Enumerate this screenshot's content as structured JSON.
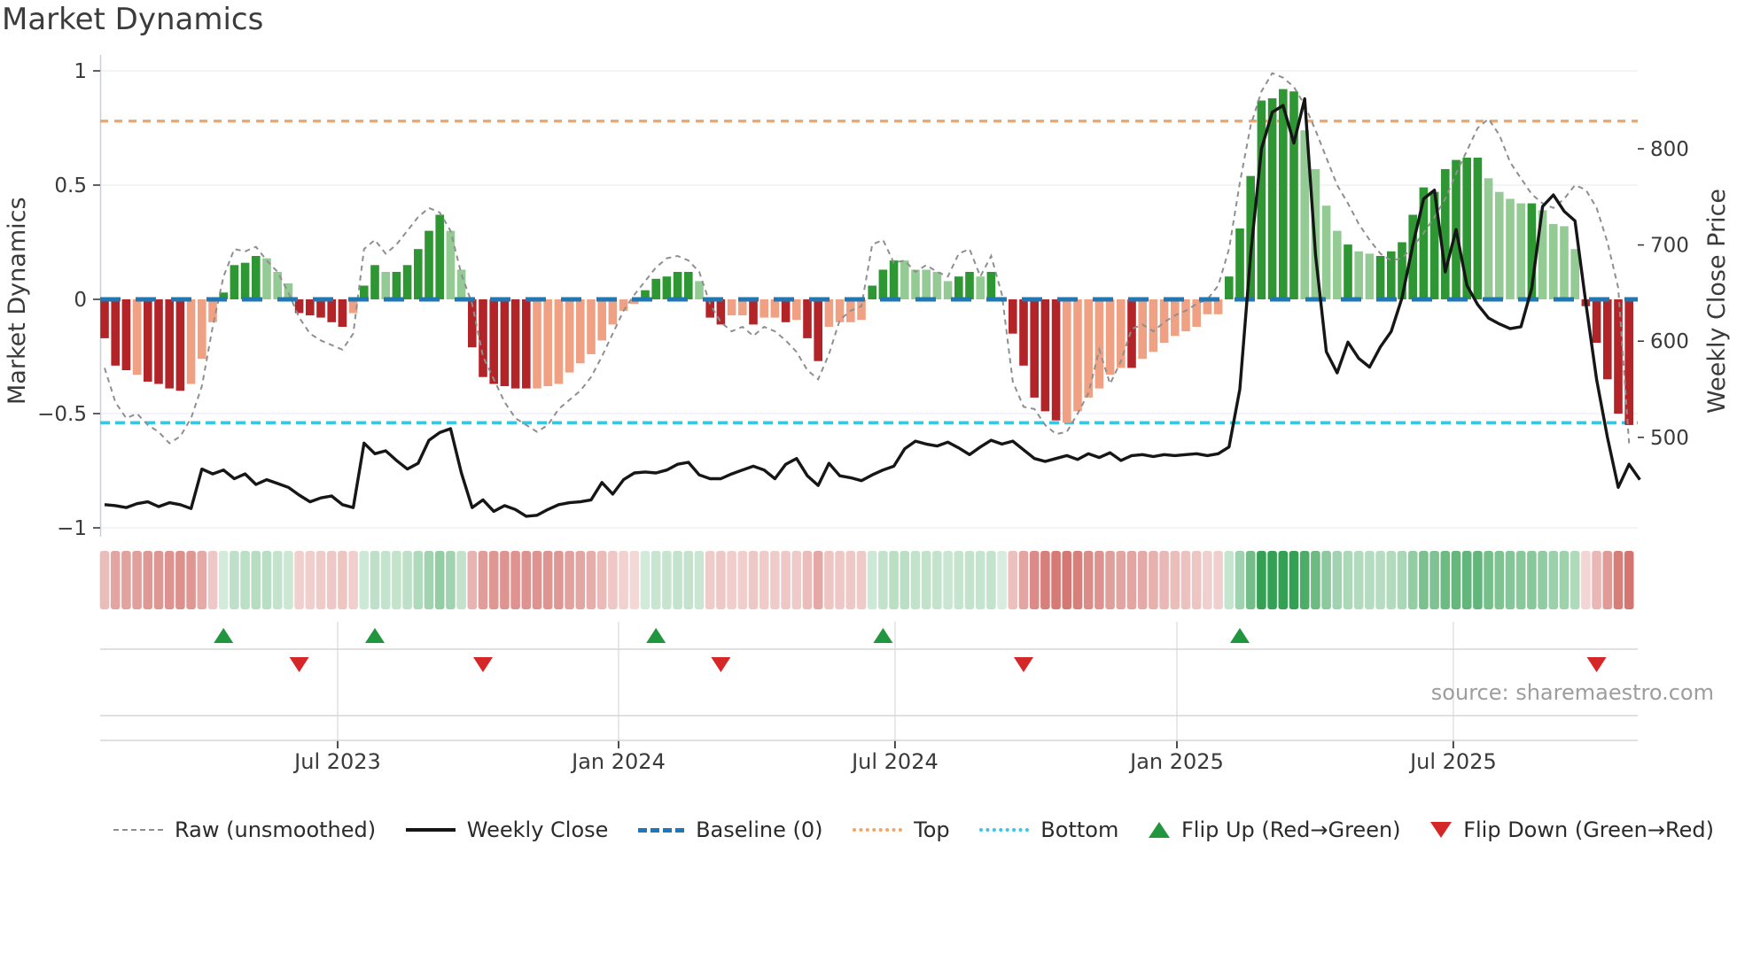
{
  "title": "Market Dynamics",
  "source": "source: sharemaestro.com",
  "colors": {
    "bar_dark_red": "#b22428",
    "bar_salmon": "#f0a183",
    "bar_dark_green": "#2e9632",
    "bar_light_green": "#94cb94",
    "strip_red": "#c23b34",
    "strip_green": "#34a053",
    "baseline": "#1f77b4",
    "top_line": "#f2a465",
    "bottom_line": "#38c6e6",
    "raw_line": "#8f8f8f",
    "price_line": "#161616",
    "flip_up": "#21963f",
    "flip_down": "#d62728",
    "grid": "#eef0f5",
    "spine": "#cdd0d8",
    "panel_line": "#d6d6d6",
    "panel_grid": "#e3e3e8"
  },
  "legend": [
    {
      "label": "Raw (unsmoothed)",
      "swatch": "raw"
    },
    {
      "label": "Weekly Close",
      "swatch": "close"
    },
    {
      "label": "Baseline (0)",
      "swatch": "base"
    },
    {
      "label": "Top",
      "swatch": "top"
    },
    {
      "label": "Bottom",
      "swatch": "bot"
    },
    {
      "label": "Flip Up (Red→Green)",
      "swatch": "up"
    },
    {
      "label": "Flip Down (Green→Red)",
      "swatch": "down"
    }
  ],
  "chart_data": {
    "type": "bar",
    "subtype": "weekly oscillator bars + raw dashed line + price line + heatmap strip + flip markers",
    "n_weeks": 142,
    "left_axis": {
      "label": "Market Dynamics",
      "ticks": [
        "1",
        "0.5",
        "0",
        "−0.5",
        "−1"
      ],
      "tick_values": [
        1,
        0.5,
        0,
        -0.5,
        -1
      ],
      "range": [
        -1.06,
        1.06
      ]
    },
    "right_axis": {
      "label": "Weekly Close Price",
      "ticks": [
        "800",
        "700",
        "600",
        "500"
      ],
      "tick_values": [
        800,
        700,
        600,
        500
      ]
    },
    "x_axis": {
      "tick_labels": [
        "Jul 2023",
        "Jan 2024",
        "Jul 2024",
        "Jan 2025",
        "Jul 2025"
      ],
      "tick_indices": [
        21.56,
        47.54,
        73.11,
        99.18,
        124.75
      ]
    },
    "reference_lines": {
      "baseline": 0,
      "top": 0.78,
      "bottom": -0.54
    },
    "grid_values": [
      1,
      0.5,
      -0.5,
      -1
    ],
    "oscillator": {
      "name": "Market Dynamics",
      "values": [
        -0.17,
        -0.29,
        -0.31,
        -0.33,
        -0.36,
        -0.37,
        -0.39,
        -0.4,
        -0.37,
        -0.26,
        -0.1,
        0.03,
        0.15,
        0.16,
        0.19,
        0.18,
        0.12,
        0.07,
        -0.06,
        -0.07,
        -0.08,
        -0.1,
        -0.12,
        -0.06,
        0.06,
        0.15,
        0.12,
        0.12,
        0.15,
        0.22,
        0.3,
        0.37,
        0.3,
        0.13,
        -0.21,
        -0.34,
        -0.37,
        -0.38,
        -0.39,
        -0.39,
        -0.39,
        -0.38,
        -0.37,
        -0.32,
        -0.28,
        -0.24,
        -0.18,
        -0.11,
        -0.05,
        -0.02,
        0.04,
        0.09,
        0.1,
        0.12,
        0.12,
        0.08,
        -0.08,
        -0.11,
        -0.07,
        -0.07,
        -0.11,
        -0.08,
        -0.08,
        -0.1,
        -0.09,
        -0.17,
        -0.27,
        -0.12,
        -0.1,
        -0.1,
        -0.09,
        0.06,
        0.13,
        0.17,
        0.17,
        0.13,
        0.13,
        0.12,
        0.08,
        0.1,
        0.12,
        0.1,
        0.12,
        0.01,
        -0.15,
        -0.29,
        -0.43,
        -0.49,
        -0.53,
        -0.54,
        -0.49,
        -0.43,
        -0.39,
        -0.33,
        -0.3,
        -0.3,
        -0.26,
        -0.23,
        -0.19,
        -0.16,
        -0.14,
        -0.12,
        -0.065,
        -0.065,
        0.1,
        0.31,
        0.54,
        0.87,
        0.88,
        0.92,
        0.91,
        0.74,
        0.57,
        0.41,
        0.3,
        0.24,
        0.21,
        0.2,
        0.19,
        0.21,
        0.25,
        0.37,
        0.49,
        0.47,
        0.57,
        0.61,
        0.62,
        0.62,
        0.53,
        0.47,
        0.44,
        0.42,
        0.42,
        0.39,
        0.33,
        0.32,
        0.22,
        -0.03,
        -0.19,
        -0.35,
        -0.5,
        -0.55
      ],
      "shades": "DDDSDDDDSSSGGGGLLLDDDDDSGGLGGGGGLLDDDDDDSSSSSSSSSSGGGGGLDDSSDSSDSDDSSSSGGGLLLLLGGLGLDDDDDSSSSSSDSSSSSSSSGGGGGGGLLLLGLLGGGGGGGGGGLLLLGLLLLDDDDD"
    },
    "raw": {
      "name": "Raw (unsmoothed)",
      "values": [
        -0.3,
        -0.45,
        -0.52,
        -0.5,
        -0.55,
        -0.58,
        -0.63,
        -0.6,
        -0.52,
        -0.38,
        -0.12,
        0.1,
        0.22,
        0.21,
        0.23,
        0.17,
        0.12,
        0.03,
        -0.08,
        -0.15,
        -0.18,
        -0.2,
        -0.22,
        -0.15,
        0.22,
        0.26,
        0.2,
        0.24,
        0.3,
        0.36,
        0.4,
        0.38,
        0.3,
        0.11,
        -0.02,
        -0.25,
        -0.35,
        -0.45,
        -0.52,
        -0.55,
        -0.58,
        -0.55,
        -0.48,
        -0.44,
        -0.4,
        -0.34,
        -0.25,
        -0.15,
        -0.05,
        0.02,
        0.08,
        0.14,
        0.18,
        0.19,
        0.17,
        0.12,
        -0.02,
        -0.1,
        -0.14,
        -0.12,
        -0.16,
        -0.12,
        -0.14,
        -0.18,
        -0.23,
        -0.31,
        -0.35,
        -0.24,
        -0.09,
        -0.05,
        -0.03,
        0.24,
        0.26,
        0.16,
        0.17,
        0.12,
        0.15,
        0.12,
        0.1,
        0.2,
        0.22,
        0.1,
        0.19,
        0.02,
        -0.36,
        -0.47,
        -0.48,
        -0.55,
        -0.59,
        -0.58,
        -0.5,
        -0.41,
        -0.22,
        -0.37,
        -0.27,
        -0.13,
        -0.11,
        -0.14,
        -0.1,
        -0.07,
        -0.05,
        -0.02,
        0.0,
        0.06,
        0.22,
        0.51,
        0.76,
        0.91,
        0.99,
        0.97,
        0.93,
        0.85,
        0.74,
        0.62,
        0.5,
        0.42,
        0.33,
        0.26,
        0.2,
        0.17,
        0.18,
        0.23,
        0.29,
        0.36,
        0.44,
        0.55,
        0.65,
        0.75,
        0.79,
        0.72,
        0.6,
        0.53,
        0.46,
        0.42,
        0.4,
        0.44,
        0.5,
        0.48,
        0.4,
        0.25,
        0.05,
        -0.63
      ]
    },
    "weekly_close": {
      "name": "Weekly Close",
      "axis": "right",
      "values": [
        430,
        429,
        427,
        431,
        433,
        428,
        432,
        430,
        426,
        467,
        462,
        466,
        457,
        462,
        451,
        456,
        452,
        448,
        440,
        433,
        437,
        439,
        430,
        427,
        494,
        483,
        486,
        476,
        467,
        473,
        497,
        505,
        509,
        463,
        427,
        435,
        423,
        429,
        425,
        418,
        419,
        425,
        430,
        432,
        433,
        435,
        453,
        441,
        456,
        463,
        464,
        463,
        466,
        472,
        474,
        461,
        457,
        457,
        462,
        466,
        470,
        466,
        457,
        472,
        478,
        460,
        450,
        473,
        460,
        458,
        455,
        461,
        466,
        470,
        488,
        496,
        493,
        491,
        495,
        489,
        482,
        490,
        497,
        493,
        496,
        487,
        478,
        475,
        478,
        481,
        477,
        483,
        479,
        484,
        476,
        481,
        482,
        480,
        482,
        481,
        482,
        483,
        481,
        483,
        490,
        550,
        690,
        800,
        838,
        845,
        806,
        852,
        690,
        589,
        567,
        599,
        582,
        573,
        594,
        610,
        645,
        700,
        748,
        757,
        672,
        716,
        658,
        638,
        624,
        618,
        613,
        615,
        655,
        740,
        752,
        735,
        725,
        640,
        560,
        500,
        448,
        472,
        456
      ]
    },
    "flip_up_indices": [
      11,
      25,
      51,
      72,
      105
    ],
    "flip_down_indices": [
      18,
      35,
      57,
      85,
      138
    ]
  }
}
